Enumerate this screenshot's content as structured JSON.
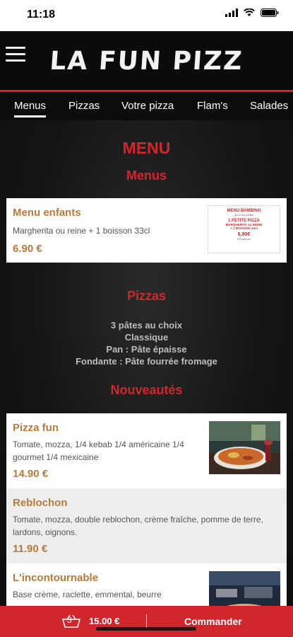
{
  "status_bar": {
    "time": "11:18",
    "icons": [
      "signal-icon",
      "wifi-icon",
      "battery-icon"
    ]
  },
  "header": {
    "logo_text": "LA FUN PIZZ",
    "menu_icon": "hamburger-icon"
  },
  "tabs": [
    {
      "label": "Menus",
      "active": true
    },
    {
      "label": "Pizzas",
      "active": false
    },
    {
      "label": "Votre pizza",
      "active": false
    },
    {
      "label": "Flam's",
      "active": false
    },
    {
      "label": "Salades",
      "active": false
    }
  ],
  "main": {
    "title": "MENU",
    "sections": {
      "menus": {
        "title": "Menus",
        "items": [
          {
            "name": "Menu enfants",
            "desc": "Margherita ou reine + 1 boisson 33cl",
            "price": "6.90 €",
            "thumb": {
              "line1": "MENU BAMBINO",
              "line2": "(pour les petits)",
              "line3": "1 PETITE PIZZA",
              "line4": "MARGHERITA ou REINE",
              "line5": "+ 1 BOISSON 33cl",
              "price": "6,90€",
              "footer": "à Emporter"
            }
          }
        ]
      },
      "pizzas": {
        "title": "Pizzas",
        "info": [
          "3 pâtes au choix",
          "Classique",
          "Pan : Pâte épaisse",
          "Fondante : Pâte fourrée fromage"
        ]
      },
      "nouveautes": {
        "title": "Nouveautés",
        "items": [
          {
            "name": "Pizza fun",
            "desc": "Tomate, mozza, 1/4 kebab 1/4 américaine 1/4 gourmet 1/4 mexicaine",
            "price": "14.90 €"
          },
          {
            "name": "Reblochon",
            "desc": "Tomate, mozza, double reblochon, crème fraîche, pomme de terre, lardons, oignons.",
            "price": "11.90 €"
          },
          {
            "name": "L'incontournable",
            "desc": "Base crème, raclette, emmental, beurre",
            "price": ""
          }
        ]
      }
    }
  },
  "bottom_bar": {
    "cart_count": "3",
    "total": "15.00 €",
    "order_label": "Commander",
    "cart_icon": "basket-icon"
  },
  "colors": {
    "accent": "#d0262c",
    "price": "#b87a3b"
  }
}
